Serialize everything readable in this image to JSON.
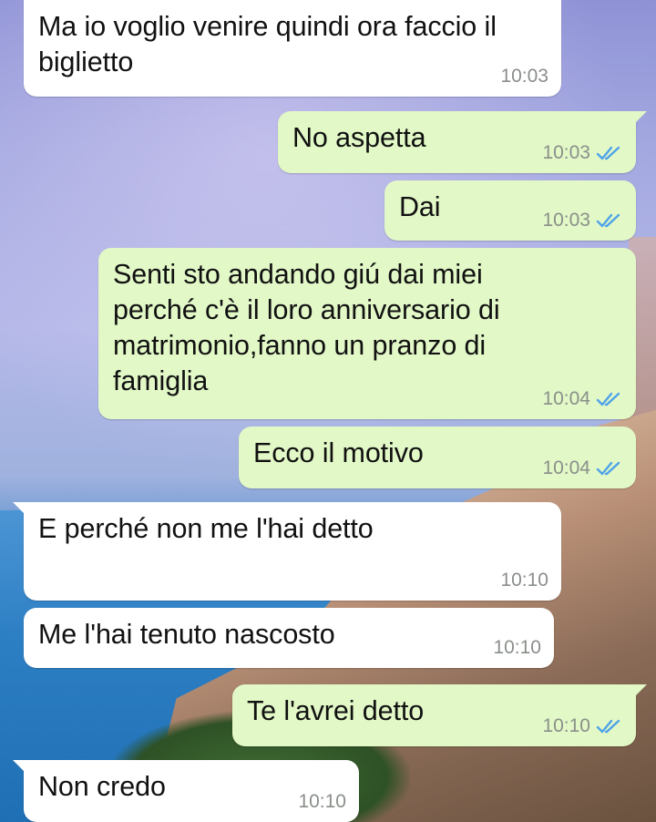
{
  "colors": {
    "incoming_bubble": "#ffffff",
    "outgoing_bubble": "#e2f8c7",
    "read_ticks": "#4fa3e8",
    "timestamp": "#8a8f8a"
  },
  "messages": [
    {
      "direction": "incoming",
      "text": "Ma io voglio venire quindi ora faccio il\nbiglietto",
      "time": "10:03"
    },
    {
      "direction": "outgoing",
      "text": "No aspetta",
      "time": "10:03",
      "status": "read-double-check-icon"
    },
    {
      "direction": "outgoing",
      "text": "Dai",
      "time": "10:03",
      "status": "read-double-check-icon"
    },
    {
      "direction": "outgoing",
      "text": "Senti sto andando giú dai miei\nperché c'è il loro anniversario di\nmatrimonio,fanno un pranzo di\nfamiglia",
      "time": "10:04",
      "status": "read-double-check-icon"
    },
    {
      "direction": "outgoing",
      "text": "Ecco il motivo",
      "time": "10:04",
      "status": "read-double-check-icon"
    },
    {
      "direction": "incoming",
      "text": "E perché non me l'hai detto",
      "time": "10:10"
    },
    {
      "direction": "incoming",
      "text": "Me l'hai tenuto nascosto",
      "time": "10:10"
    },
    {
      "direction": "outgoing",
      "text": "Te l'avrei detto",
      "time": "10:10",
      "status": "read-double-check-icon"
    },
    {
      "direction": "incoming",
      "text": "Non credo",
      "time": "10:10"
    }
  ]
}
